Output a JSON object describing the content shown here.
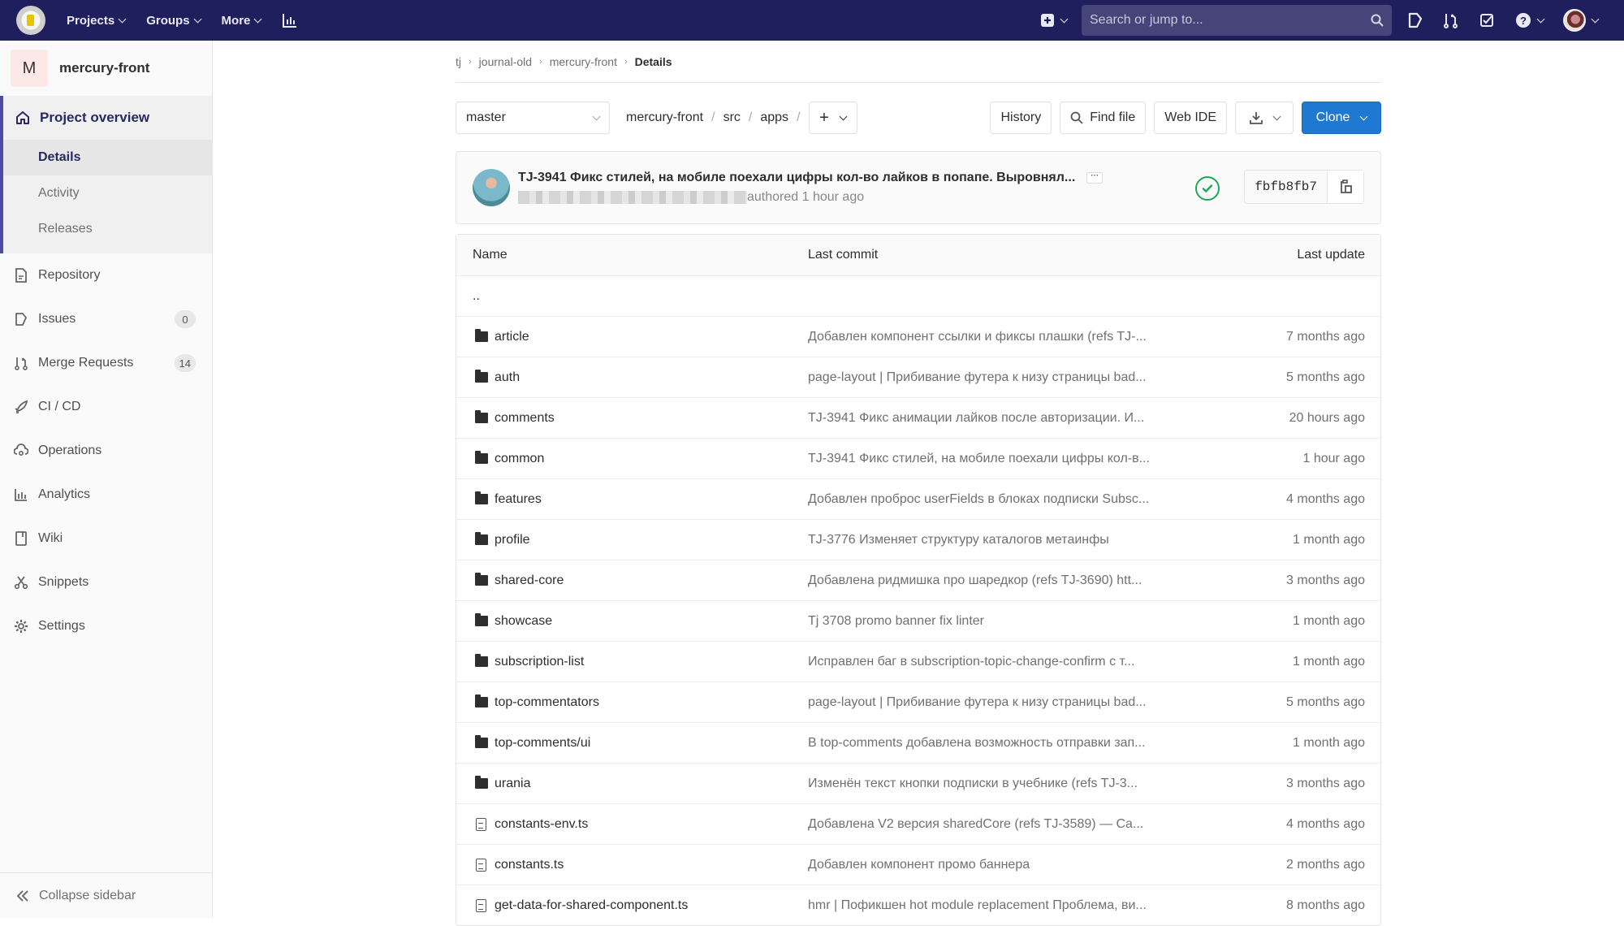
{
  "navbar": {
    "projects": "Projects",
    "groups": "Groups",
    "more": "More",
    "search_placeholder": "Search or jump to..."
  },
  "sidebar": {
    "project_initial": "M",
    "project_name": "mercury-front",
    "overview": {
      "label": "Project overview",
      "items": [
        "Details",
        "Activity",
        "Releases"
      ],
      "active": "Details"
    },
    "items": [
      {
        "label": "Repository",
        "icon": "document-icon"
      },
      {
        "label": "Issues",
        "icon": "issues-icon",
        "badge": "0"
      },
      {
        "label": "Merge Requests",
        "icon": "merge-request-icon",
        "badge": "14"
      },
      {
        "label": "CI / CD",
        "icon": "rocket-icon"
      },
      {
        "label": "Operations",
        "icon": "cloud-gear-icon"
      },
      {
        "label": "Analytics",
        "icon": "chart-icon"
      },
      {
        "label": "Wiki",
        "icon": "book-icon"
      },
      {
        "label": "Snippets",
        "icon": "scissors-icon"
      },
      {
        "label": "Settings",
        "icon": "gear-icon"
      }
    ],
    "collapse": "Collapse sidebar"
  },
  "breadcrumb": [
    "tj",
    "journal-old",
    "mercury-front",
    "Details"
  ],
  "toolbar": {
    "branch": "master",
    "path": [
      "mercury-front",
      "src",
      "apps"
    ],
    "history": "History",
    "find_file": "Find file",
    "web_ide": "Web IDE",
    "clone": "Clone"
  },
  "last_commit": {
    "title": "TJ-3941 Фикс стилей, на мобиле поехали цифры кол-во лайков в попапе. Выровнял...",
    "authored": "authored 1 hour ago",
    "sha": "fbfb8fb7",
    "pipeline_status": "passed",
    "status_color": "#1aaa55"
  },
  "tree": {
    "headers": {
      "name": "Name",
      "last_commit": "Last commit",
      "last_update": "Last update"
    },
    "up": "..",
    "rows": [
      {
        "type": "folder",
        "name": "article",
        "commit": "Добавлен компонент ссылки и фиксы плашки (refs TJ-...",
        "date": "7 months ago"
      },
      {
        "type": "folder",
        "name": "auth",
        "commit": "page-layout | Прибивание футера к низу страницы bad...",
        "date": "5 months ago"
      },
      {
        "type": "folder",
        "name": "comments",
        "commit": "TJ-3941 Фикс анимации лайков после авторизации. И...",
        "date": "20 hours ago"
      },
      {
        "type": "folder",
        "name": "common",
        "commit": "TJ-3941 Фикс стилей, на мобиле поехали цифры кол-в...",
        "date": "1 hour ago"
      },
      {
        "type": "folder",
        "name": "features",
        "commit": "Добавлен проброс userFields в блоках подписки Subsc...",
        "date": "4 months ago"
      },
      {
        "type": "folder",
        "name": "profile",
        "commit": "TJ-3776 Изменяет структуру каталогов метаинфы",
        "date": "1 month ago"
      },
      {
        "type": "folder",
        "name": "shared-core",
        "commit": "Добавлена ридмишка про шаредкор (refs TJ-3690) htt...",
        "date": "3 months ago"
      },
      {
        "type": "folder",
        "name": "showcase",
        "commit": "Tj 3708 promo banner fix linter",
        "date": "1 month ago"
      },
      {
        "type": "folder",
        "name": "subscription-list",
        "commit": "Исправлен баг в subscription-topic-change-confirm с т...",
        "date": "1 month ago"
      },
      {
        "type": "folder",
        "name": "top-commentators",
        "commit": "page-layout | Прибивание футера к низу страницы bad...",
        "date": "5 months ago"
      },
      {
        "type": "folder",
        "name": "top-comments/ui",
        "commit": "В top-comments добавлена возможность отправки зап...",
        "date": "1 month ago"
      },
      {
        "type": "folder",
        "name": "urania",
        "commit": "Изменён текст кнопки подписки в учебнике (refs TJ-3...",
        "date": "3 months ago"
      },
      {
        "type": "file",
        "name": "constants-env.ts",
        "commit": "Добавлена V2 версия sharedCore (refs TJ-3589) — Ca...",
        "date": "4 months ago"
      },
      {
        "type": "file",
        "name": "constants.ts",
        "commit": "Добавлен компонент промо баннера",
        "date": "2 months ago"
      },
      {
        "type": "file",
        "name": "get-data-for-shared-component.ts",
        "commit": "hmr | Пофикшен hot module replacement Проблема, ви...",
        "date": "8 months ago"
      }
    ]
  },
  "colors": {
    "navbar": "#1f1f5e",
    "accent": "#292961",
    "primary_button": "#1f78d1",
    "success": "#1aaa55"
  }
}
